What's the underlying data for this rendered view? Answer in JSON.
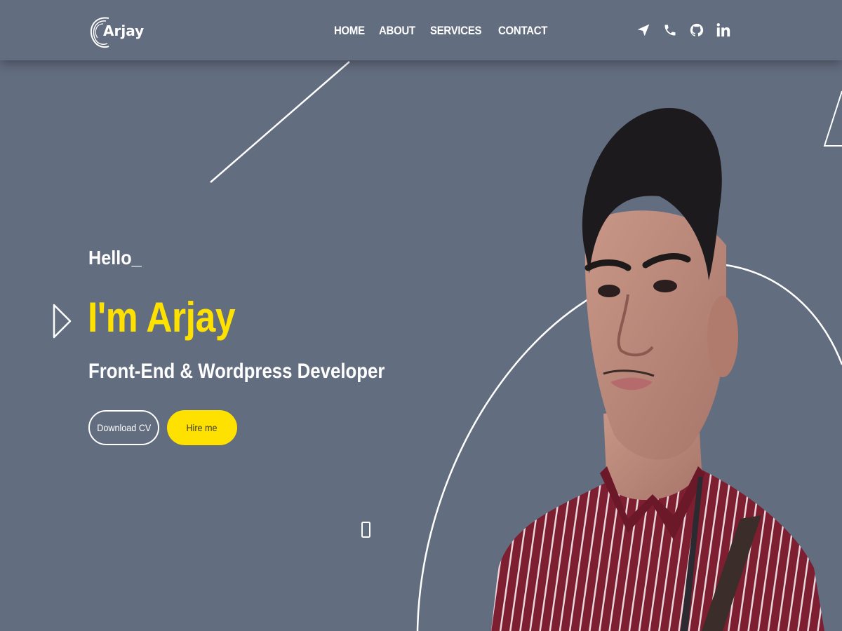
{
  "header": {
    "logo_text": "Arjay",
    "nav": [
      {
        "label": "HOME"
      },
      {
        "label": "ABOUT"
      },
      {
        "label": "SERVICES"
      },
      {
        "label": "CONTACT"
      }
    ],
    "socials": [
      {
        "icon": "send-icon"
      },
      {
        "icon": "phone-icon"
      },
      {
        "icon": "github-icon"
      },
      {
        "icon": "linkedin-icon"
      }
    ]
  },
  "hero": {
    "greeting": "Hello_",
    "name": "I'm Arjay",
    "role": "Front-End & Wordpress Developer",
    "download_cv_label": "Download CV",
    "hire_me_label": "Hire me"
  },
  "colors": {
    "background": "#636d80",
    "accent": "#ffe100",
    "text": "#ffffff",
    "shirt": "#7d1f31"
  }
}
